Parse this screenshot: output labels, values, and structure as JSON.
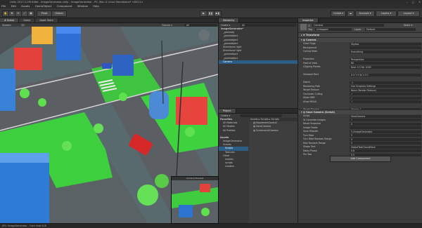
{
  "window": {
    "title": "Unity 2017.2.0f3 64bit - ImageGenerator.unity - ImageGenerator - PC, Mac & Linux Standalone* <DX11>"
  },
  "menu": [
    "File",
    "Edit",
    "Assets",
    "GameObject",
    "Component",
    "Window",
    "Help"
  ],
  "toolbar": {
    "pivot": "Pivot",
    "space": "Global",
    "collab": "Collab ▾",
    "account": "Account ▾",
    "layers": "Layers ▾",
    "layout": "Layout ▾"
  },
  "scene": {
    "tabs": [
      "# Scene",
      "Game",
      "Asset Store"
    ],
    "shading": "Shaded",
    "mode": "2D",
    "gizmos": "Gizmos ▾",
    "search": "All",
    "preview_label": "Camera Preview"
  },
  "hierarchy": {
    "tab": "Hierarchy",
    "create": "Create ▾",
    "search": "All",
    "items": [
      "ImageGenerator*",
      "_gameobj",
      "_gameobject",
      "_gameobject",
      "_gameobject",
      "Directional light",
      "Directional light",
      "_gameobject",
      "_gameobject",
      "Camera"
    ],
    "selected_index": 9
  },
  "project": {
    "tab": "Project",
    "create": "Create ▾",
    "favorites": [
      "Favorites",
      "All Materials",
      "All Models",
      "All Prefabs"
    ],
    "tree": [
      "Assets",
      "ImageGenerator",
      "Scenes",
      "Scripts",
      "Textures",
      "Other",
      "models",
      "scripts",
      "shaders"
    ],
    "breadcrumb": "Assets ▸ Scripts ▸ Scripts",
    "files": [
      "MovementControl",
      "SaveCamera",
      "ScreenshotCamera"
    ]
  },
  "inspector": {
    "tab": "Inspector",
    "object_name": "Camera",
    "static": "Static ▾",
    "tag": "Untagged",
    "layer": "Default",
    "transform": "Transform",
    "camera_section": "Camera",
    "camera_fields": [
      {
        "k": "Clear Flags",
        "v": "Skybox"
      },
      {
        "k": "Background",
        "v": ""
      },
      {
        "k": "Culling Mask",
        "v": "Everything"
      },
      {
        "k": "",
        "v": ""
      },
      {
        "k": "Projection",
        "v": "Perspective"
      },
      {
        "k": "Field of View",
        "v": "60"
      },
      {
        "k": "Clipping Planes",
        "v": "Near 0.3   Far 1000"
      },
      {
        "k": "",
        "v": ""
      },
      {
        "k": "Viewport Rect",
        "v": "X 0   Y 0   W 1   H 1"
      },
      {
        "k": "",
        "v": ""
      },
      {
        "k": "Depth",
        "v": "-1"
      },
      {
        "k": "Rendering Path",
        "v": "Use Graphics Settings"
      },
      {
        "k": "Target Texture",
        "v": "None (Render Texture)"
      },
      {
        "k": "Occlusion Culling",
        "v": "✓"
      },
      {
        "k": "Allow HDR",
        "v": "✓"
      },
      {
        "k": "Allow MSAA",
        "v": "✓"
      },
      {
        "k": "",
        "v": ""
      },
      {
        "k": "Target Display",
        "v": "Display 1"
      }
    ],
    "script_section": "Save Camera (Script)",
    "script_fields": [
      {
        "k": "Script",
        "v": "SaveCamera"
      },
      {
        "k": "To Generate Images",
        "v": "✓"
      },
      {
        "k": "Reset Snapshot",
        "v": "0"
      },
      {
        "k": "Image Folder",
        "v": ""
      },
      {
        "k": "Save Filepath",
        "v": "C:/ImageGenerator"
      },
      {
        "k": "Turn Rate",
        "v": "5"
      },
      {
        "k": "Turn Rate Random Range",
        "v": "5"
      },
      {
        "k": "Max Random Range",
        "v": "5"
      },
      {
        "k": "Shape Text",
        "v": "GlobalTextCheckMesh"
      },
      {
        "k": "Delay Phase",
        "v": "0.8"
      },
      {
        "k": "Per Yaw",
        "v": "0.5"
      }
    ],
    "add_component": "Add Component"
  },
  "status": "JPG: ImageGenerator - Cam shot 418"
}
